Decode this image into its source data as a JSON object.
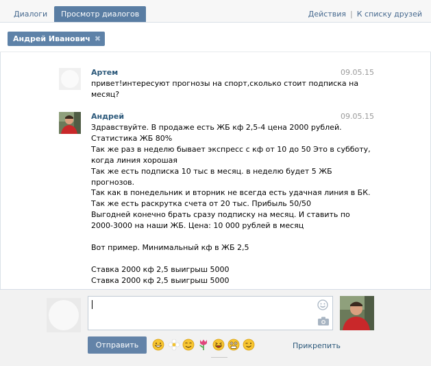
{
  "tabs": [
    {
      "label": "Диалоги",
      "active": false
    },
    {
      "label": "Просмотр диалогов",
      "active": true
    }
  ],
  "header_links": {
    "actions": "Действия",
    "separator": "|",
    "friends": "К списку друзей"
  },
  "chip": {
    "label": "Андрей Иванович",
    "close": "✖"
  },
  "messages": [
    {
      "author": "Артем",
      "date": "09.05.15",
      "avatar_icon": "blank-avatar-icon",
      "lines": [
        "привет!интересуют прогнозы на спорт,сколько стоит подписка на",
        "месяц?"
      ]
    },
    {
      "author": "Андрей",
      "date": "09.05.15",
      "avatar_icon": "user-photo-icon",
      "lines": [
        "Здравствуйте. В продаже есть ЖБ кф 2,5-4 цена 2000 рублей.",
        "Статистика ЖБ 80%",
        "Так же раз в неделю бывает экспресс с кф от 10 до 50 Это в субботу,",
        "когда линия хорошая",
        "Так же есть подписка 10 тыс в месяц. в неделю будет 5 ЖБ",
        "прогнозов.",
        "Так как в понедельник и вторник не всегда есть удачная линия в БК.",
        "Так же есть раскрутка счета от 20 тыс. Прибыль 50/50",
        "Выгодней конечно брать сразу подписку на месяц. И ставить по",
        "2000-3000 на наши ЖБ. Цена: 10 000 рублей в месяц",
        "",
        "Вот пример. Минимальный кф в ЖБ 2,5",
        "",
        "Ставка 2000 кф 2,5 выигрыш 5000",
        "Ставка 2000 кф 2,5 выигрыш 5000"
      ]
    }
  ],
  "compose": {
    "input_value": "",
    "send_label": "Отправить",
    "attach_label": "Прикрепить",
    "emojis": [
      "grin-emoji-icon",
      "flower-emoji-icon",
      "smile-emoji-icon",
      "tulip-emoji-icon",
      "laugh-emoji-icon",
      "shock-emoji-icon",
      "wink-emoji-icon"
    ]
  },
  "colors": {
    "active_tab": "#597da3",
    "link": "#2b587a",
    "chip": "#5e82a8",
    "send_button": "#6383a8"
  }
}
